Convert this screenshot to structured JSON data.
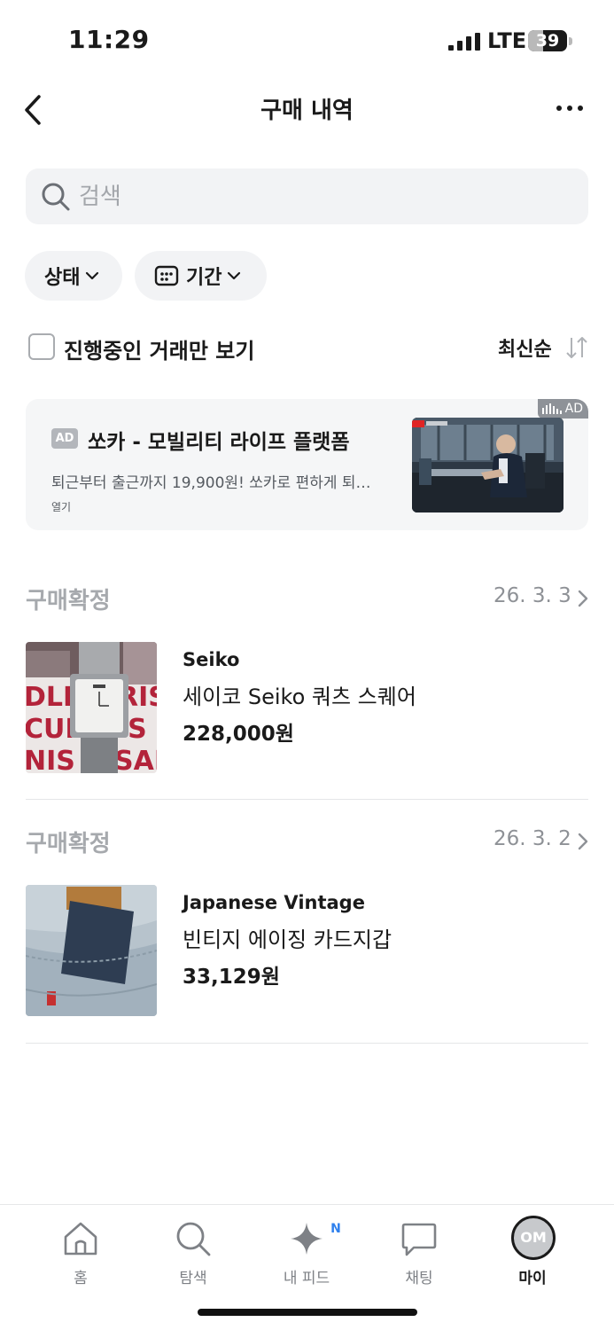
{
  "status_bar": {
    "time": "11:29",
    "network": "LTE",
    "battery": "39",
    "battery_level": 0.39
  },
  "header": {
    "title": "구매 내역",
    "back_icon": "chevron-left-icon",
    "more_icon": "more-horizontal-icon"
  },
  "search": {
    "placeholder": "검색",
    "value": ""
  },
  "filters": {
    "status_label": "상태",
    "period_label": "기간"
  },
  "options": {
    "in_progress_only_label": "진행중인 거래만 보기",
    "in_progress_only_checked": false,
    "sort_label": "최신순"
  },
  "ad": {
    "corner_label": "AD",
    "badge": "AD",
    "title": "쏘카 - 모빌리티 라이프 플랫폼",
    "description": "퇴근부터 출근까지 19,900원! 쏘카로 편하게 퇴…",
    "open_label": "열기"
  },
  "orders": [
    {
      "status": "구매확정",
      "date": "26. 3. 3",
      "brand": "Seiko",
      "name": "세이코 Seiko 쿼츠 스퀘어",
      "price": "228,000원"
    },
    {
      "status": "구매확정",
      "date": "26. 3. 2",
      "brand": "Japanese Vintage",
      "name": "빈티지 에이징 카드지갑",
      "price": "33,129원"
    }
  ],
  "tab_bar": {
    "tabs": [
      {
        "label": "홈",
        "icon": "home-icon",
        "active": false
      },
      {
        "label": "탐색",
        "icon": "search-icon",
        "active": false
      },
      {
        "label": "내 피드",
        "icon": "sparkle-icon",
        "active": false,
        "badge": "N"
      },
      {
        "label": "채팅",
        "icon": "chat-icon",
        "active": false
      },
      {
        "label": "마이",
        "icon": "avatar",
        "active": true,
        "avatar_initials": "OM"
      }
    ]
  },
  "colors": {
    "text": "#1a1a1a",
    "muted": "#a6a9ad",
    "surface": "#f2f3f5",
    "badge_blue": "#2f80ed"
  }
}
